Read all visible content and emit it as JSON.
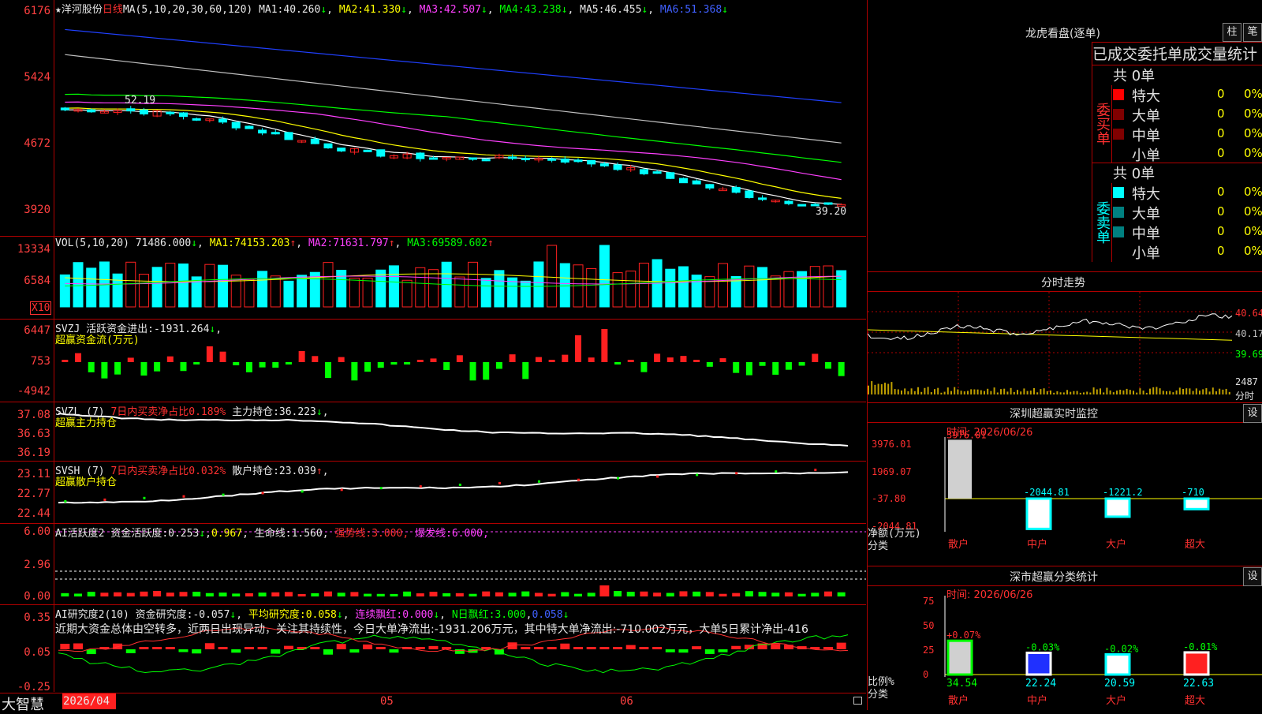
{
  "colors": {
    "up": "#ff2020",
    "down": "#00ffff",
    "ma1": "#ffffff",
    "ma2": "#ffff00",
    "ma3": "#ff40ff",
    "ma4": "#00ff00",
    "ma5": "#c0c0c0",
    "ma6": "#2040ff",
    "grid": "#b00000"
  },
  "kline": {
    "star": "★",
    "name": "洋河股份",
    "period": "日线",
    "ma_label": "MA(5,10,20,30,60,120)",
    "ma": [
      {
        "label": "MA1:",
        "value": "40.260",
        "arrow": "↓"
      },
      {
        "label": "MA2:",
        "value": "41.330",
        "arrow": "↓"
      },
      {
        "label": "MA3:",
        "value": "42.507",
        "arrow": "↓"
      },
      {
        "label": "MA4:",
        "value": "43.238",
        "arrow": "↓"
      },
      {
        "label": "MA5:",
        "value": "46.455",
        "arrow": "↓"
      },
      {
        "label": "MA6:",
        "value": "51.368",
        "arrow": "↓"
      }
    ],
    "ticks": [
      "6176",
      "5424",
      "4672",
      "3920"
    ],
    "high_label": "52.19",
    "low_label": "39.20"
  },
  "vol": {
    "title": "VOL(5,10,20)",
    "value": "71486.000",
    "arrow": "↓",
    "ma": [
      {
        "label": "MA1:",
        "value": "74153.203",
        "arrow": "↑"
      },
      {
        "label": "MA2:",
        "value": "71631.797",
        "arrow": "↑"
      },
      {
        "label": "MA3:",
        "value": "69589.602",
        "arrow": "↑"
      }
    ],
    "ticks": [
      "13334",
      "6584"
    ],
    "unit": "X10"
  },
  "svzj": {
    "title": "SVZJ",
    "label": "活跃资金进出:",
    "value": "-1931.264",
    "arrow": "↓",
    "sep": ",",
    "subtitle": "超赢资金流(万元)",
    "ticks": [
      "6447",
      "753",
      "-4942"
    ]
  },
  "svzl": {
    "title": "SVZL (7)",
    "label": "7日内买卖净占比",
    "value": "0.189%",
    "label2": "主力持仓:",
    "value2": "36.223",
    "arrow": "↓",
    "sep": ",",
    "subtitle": "超赢主力持仓",
    "ticks": [
      "37.08",
      "36.63",
      "36.19"
    ]
  },
  "svsh": {
    "title": "SVSH (7)",
    "label": "7日内买卖净占比",
    "value": "0.032%",
    "label2": "散户持仓:",
    "value2": "23.039",
    "arrow": "↑",
    "sep": ",",
    "subtitle": "超赢散户持仓",
    "ticks": [
      "23.11",
      "22.77",
      "22.44"
    ]
  },
  "ai1": {
    "title": "AI活跃度2",
    "label": "资金活跃度:",
    "v1": "0.253",
    "a1": "↓",
    "sep1": ",",
    "v2": "0.967",
    "sep2": ",",
    "label3": "生命线:",
    "v3": "1.560",
    "sep3": ",",
    "label4": "强势线:",
    "v4": "3.000",
    "sep4": ",",
    "label5": "爆发线:",
    "v5": "6.000",
    "sep5": ",",
    "ticks": [
      "6.00",
      "2.96",
      "0.00"
    ]
  },
  "ai2": {
    "title": "AI研究度2(10)",
    "label": "资金研究度:",
    "v1": "-0.057",
    "a1": "↓",
    "sep1": ",",
    "label2": "平均研究度:",
    "v2": "0.058",
    "a2": "↓",
    "sep2": ",",
    "label3": "连续飘红:",
    "v3": "0.000",
    "a3": "↓",
    "sep3": ",",
    "label4": "N日飘红:",
    "v4": "3.000",
    "sep4": ",",
    "v5": "0.058",
    "a5": "↓",
    "note": "近期大资金总体由空转多，近两日出现异动，关注其持续性，今日大单净流出:-1931.206万元，其中特大单净流出:-710.002万元，大单5日累计净出-416",
    "ticks": [
      "0.35",
      "0.05",
      "-0.25"
    ]
  },
  "bottom": {
    "logo": "大智慧",
    "date1": "2026/04",
    "date2": "05",
    "date3": "06"
  },
  "right": {
    "lhb_title": "龙虎看盘(逐单)",
    "btn1": "柱",
    "btn2": "笔",
    "stat_title": "已成交委托单成交量统计",
    "buy": {
      "side": "委买单",
      "total": "共 0单",
      "rows": [
        {
          "label": "特大",
          "count": "0",
          "pct": "0%",
          "color": "#ff0000"
        },
        {
          "label": "大单",
          "count": "0",
          "pct": "0%",
          "color": "#800000"
        },
        {
          "label": "中单",
          "count": "0",
          "pct": "0%",
          "color": "#800000"
        },
        {
          "label": "小单",
          "count": "0",
          "pct": "0%",
          "color": ""
        }
      ]
    },
    "sell": {
      "side": "委卖单",
      "total": "共 0单",
      "rows": [
        {
          "label": "特大",
          "count": "0",
          "pct": "0%",
          "color": "#00ffff"
        },
        {
          "label": "大单",
          "count": "0",
          "pct": "0%",
          "color": "#008080"
        },
        {
          "label": "中单",
          "count": "0",
          "pct": "0%",
          "color": "#008080"
        },
        {
          "label": "小单",
          "count": "0",
          "pct": "0%",
          "color": ""
        }
      ]
    },
    "intraday": {
      "title": "分时走势",
      "ticks": [
        "40.64",
        "40.17",
        "39.69",
        "2487"
      ],
      "unit": "分时"
    },
    "monitor": {
      "title": "深圳超赢实时监控",
      "btn": "设",
      "time": "时间: 2026/06/26",
      "ticks": [
        "3976.01",
        "1969.07",
        "-37.80",
        "-2044.81"
      ],
      "ylabel": "净额(万元)",
      "xlabel": "分类",
      "bars": [
        {
          "name": "散户",
          "value": "3976.01"
        },
        {
          "name": "中户",
          "value": "-2044.81"
        },
        {
          "name": "大户",
          "value": "-1221.2"
        },
        {
          "name": "超大",
          "value": "-710"
        }
      ]
    },
    "classify": {
      "title": "深市超赢分类统计",
      "btn": "设",
      "time": "时间: 2026/06/26",
      "ticks": [
        "75",
        "50",
        "25",
        "0"
      ],
      "ylabel": "比例%",
      "xlabel": "分类",
      "bars": [
        {
          "name": "散户",
          "value": "34.54",
          "chg": "+0.07%"
        },
        {
          "name": "中户",
          "value": "22.24",
          "chg": "-0.03%"
        },
        {
          "name": "大户",
          "value": "20.59",
          "chg": "-0.02%"
        },
        {
          "name": "超大",
          "value": "22.63",
          "chg": "-0.01%"
        }
      ]
    }
  }
}
